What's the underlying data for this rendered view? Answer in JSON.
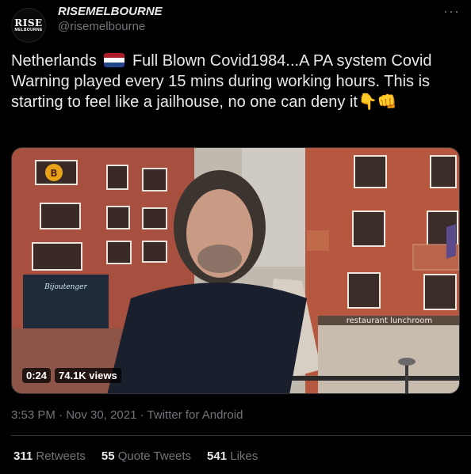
{
  "account": {
    "display_name": "RISEMELBOURNE",
    "handle": "@risemelbourne",
    "avatar_line1": "RISE",
    "avatar_line2": "MELBOURNE"
  },
  "menu_icon": "more-horizontal-icon",
  "tweet": {
    "text_part1": "Netherlands",
    "text_part2": "Full Blown Covid1984...A PA system Covid Warning played every 15 mins during working hours. This is starting to feel like a jailhouse, no one can deny it",
    "emoji_trailing": "👇👊",
    "flag": {
      "colors": [
        "#ae1c28",
        "#ffffff",
        "#21468b"
      ],
      "icon": "netherlands-flag-icon"
    }
  },
  "video": {
    "duration": "0:24",
    "views": "74.1K views",
    "sign_text": "restaurant lunchroom",
    "shop_text": "Bijoutenger"
  },
  "meta": {
    "time": "3:53 PM",
    "date": "Nov 30, 2021",
    "source": "Twitter for Android",
    "separator": "·"
  },
  "stats": {
    "retweets_count": "311",
    "retweets_label": "Retweets",
    "quotes_count": "55",
    "quotes_label": "Quote Tweets",
    "likes_count": "541",
    "likes_label": "Likes"
  }
}
